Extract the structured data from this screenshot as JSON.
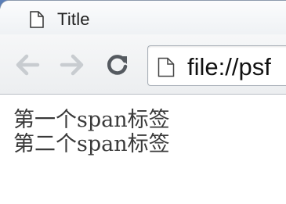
{
  "browser": {
    "tab": {
      "title": "Title",
      "icon": "page-icon"
    },
    "toolbar": {
      "back_icon": "back-arrow-icon",
      "forward_icon": "forward-arrow-icon",
      "reload_icon": "reload-icon",
      "address": "file://psf"
    }
  },
  "page": {
    "spans": [
      "第一个span标签",
      "第二个span标签"
    ]
  }
}
